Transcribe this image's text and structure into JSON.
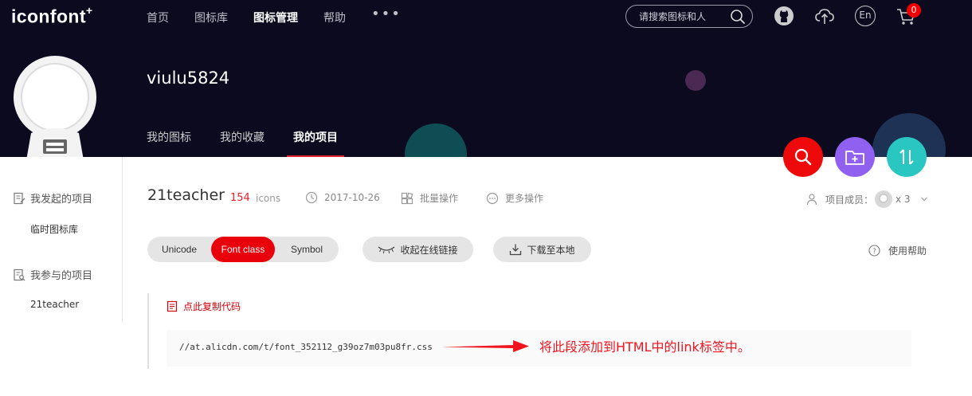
{
  "header": {
    "logo_text": "iconfont",
    "logo_mark": "+",
    "nav": [
      "首页",
      "图标库",
      "图标管理",
      "帮助"
    ],
    "nav_active_index": 2,
    "nav_more": "•••",
    "search_placeholder": "请搜索图标和人",
    "cart_count": "0",
    "lang_label": "En",
    "icons": [
      "github-icon",
      "upload-cloud-icon",
      "language-icon",
      "cart-icon"
    ]
  },
  "profile": {
    "username": "viulu5824",
    "tabs": [
      "我的图标",
      "我的收藏",
      "我的项目"
    ],
    "active_tab_index": 2
  },
  "fabs": [
    "search-icon",
    "folder-add-icon",
    "sort-icon"
  ],
  "sidebar": {
    "started_label": "我发起的项目",
    "started_items": [
      "临时图标库"
    ],
    "joined_label": "我参与的项目",
    "joined_items": [
      "21teacher"
    ]
  },
  "project": {
    "name": "21teacher",
    "icon_count": "154",
    "icon_count_unit": "icons",
    "date": "2017-10-26",
    "batch_label": "批量操作",
    "more_label": "更多操作",
    "members_label": "项目成员：",
    "members_count": "x 3"
  },
  "toolbar": {
    "modes": [
      "Unicode",
      "Font class",
      "Symbol"
    ],
    "active_mode_index": 1,
    "collapse_link_label": "收起在线链接",
    "download_label": "下载至本地",
    "help_label": "使用帮助"
  },
  "code": {
    "copy_label": "点此复制代码",
    "url": "//at.alicdn.com/t/font_352112_g39oz7m03pu8fr.css"
  },
  "annotation": {
    "text": "将此段添加到HTML中的link标签中。",
    "color": "#f0141e"
  },
  "colors": {
    "header_bg": "#0b0a1f",
    "accent_red": "#e8000b",
    "fab_purple": "#9061f0",
    "fab_teal": "#2ac7c2"
  }
}
